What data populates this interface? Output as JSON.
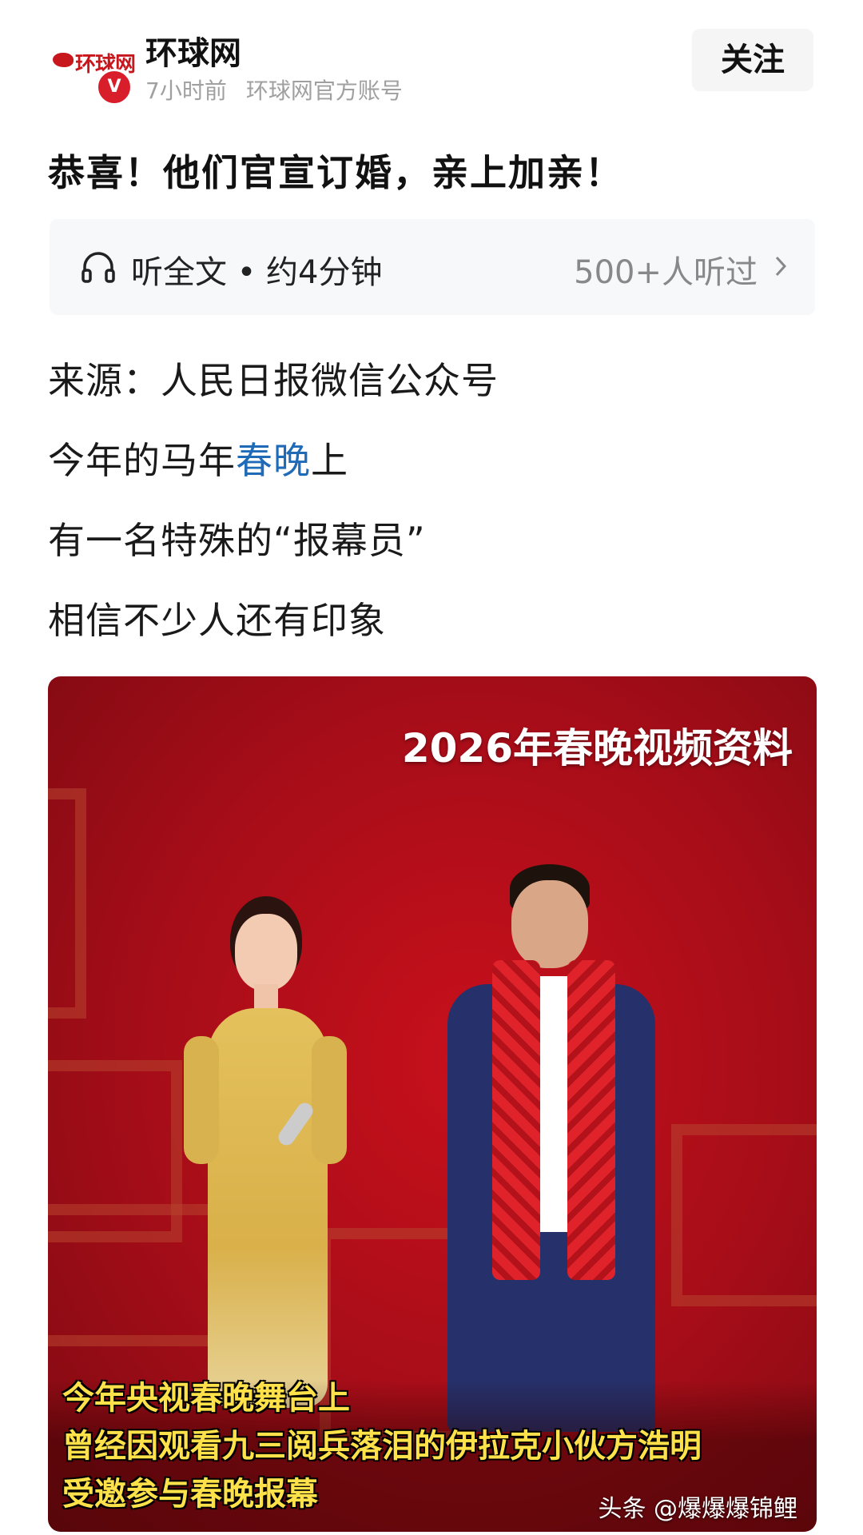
{
  "account": {
    "name": "环球网",
    "time": "7小时前",
    "type": "环球网官方账号",
    "logo_text": "环球网",
    "verified_mark": "V",
    "follow_label": "关注"
  },
  "article": {
    "title": "恭喜！他们官宣订婚，亲上加亲！",
    "listen": {
      "label": "听全文 • 约4分钟",
      "count": "500+人听过"
    },
    "paragraphs": [
      {
        "text": "来源：人民日报微信公众号"
      },
      {
        "before": "今年的马年",
        "link": "春晚",
        "after": "上"
      },
      {
        "text": "有一名特殊的“报幕员”"
      },
      {
        "text": "相信不少人还有印象"
      }
    ]
  },
  "video": {
    "overlay_title": "2026年春晚视频资料",
    "captions": [
      "今年央视春晚舞台上",
      "曾经因观看九三阅兵落泪的伊拉克小伙方浩明",
      "受邀参与春晚报幕"
    ],
    "watermark": "头条 @爆爆爆锦鲤"
  },
  "icons": {
    "listen": "headphone-icon",
    "more": "chevron-right-icon"
  },
  "colors": {
    "brand_red": "#c8161d",
    "link_blue": "#1f6bb8",
    "caption_yellow": "#ffe14a"
  }
}
